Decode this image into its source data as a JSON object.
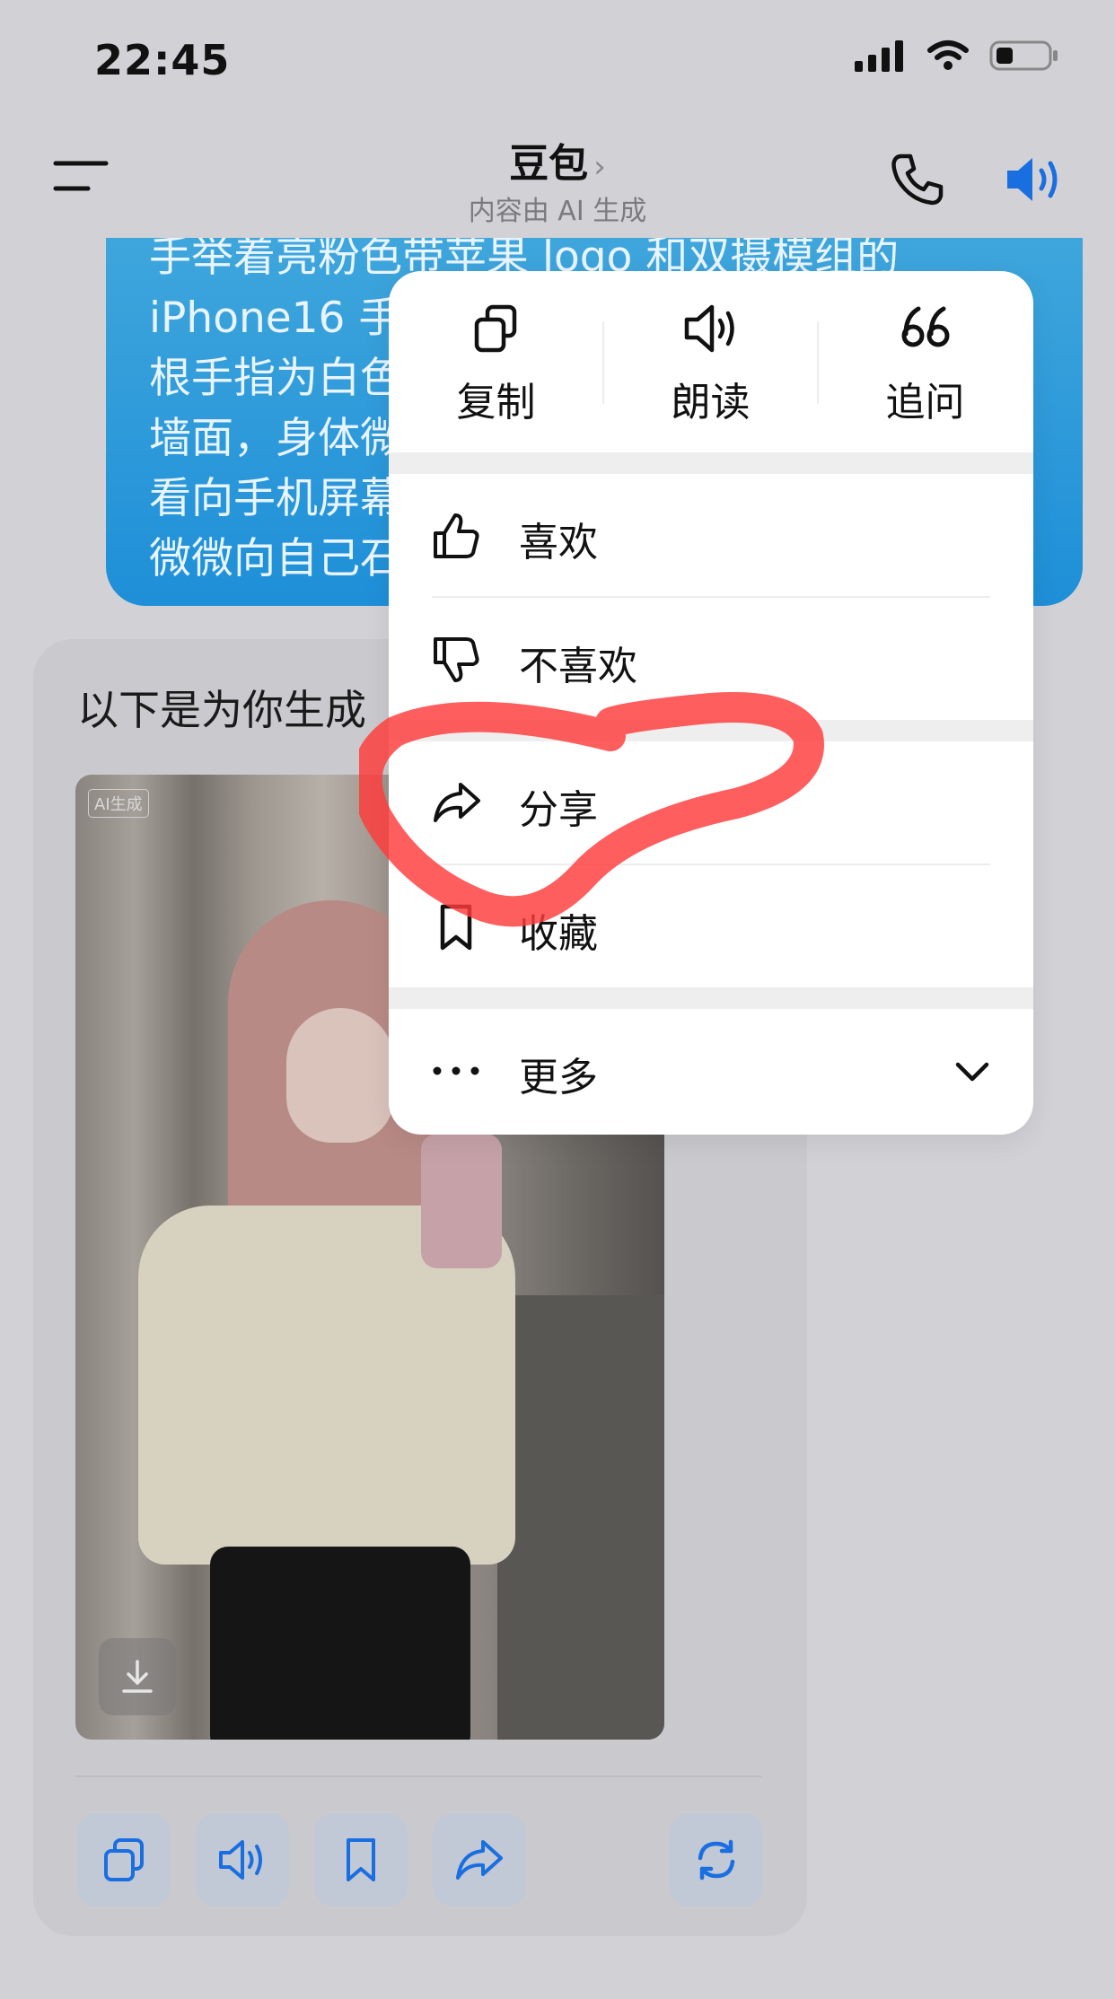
{
  "status_bar": {
    "time": "22:45"
  },
  "header": {
    "title": "豆包",
    "title_chevron": "›",
    "subtitle": "内容由 AI 生成"
  },
  "user_message": {
    "lines": [
      "手举着亮粉色带苹果 logo 和双摄模组的",
      "iPhone16 手",
      "根手指为白色",
      "墙面，身体微",
      "看向手机屏幕",
      "微微向自己石"
    ]
  },
  "assistant": {
    "intro_text": "以下是为你生成",
    "image_tag": "AI生成"
  },
  "context_menu": {
    "top_actions": [
      {
        "label": "复制",
        "icon": "copy-icon"
      },
      {
        "label": "朗读",
        "icon": "speaker-icon"
      },
      {
        "label": "追问",
        "icon": "quote-icon"
      }
    ],
    "items": [
      {
        "label": "喜欢",
        "icon": "thumbs-up-icon"
      },
      {
        "label": "不喜欢",
        "icon": "thumbs-down-icon"
      },
      {
        "label": "分享",
        "icon": "share-icon"
      },
      {
        "label": "收藏",
        "icon": "bookmark-icon"
      },
      {
        "label": "更多",
        "icon": "more-dots-icon"
      }
    ]
  },
  "colors": {
    "accent": "#1a6fe0",
    "bubble": "#1e8fd8",
    "annotation": "#ff3b3b",
    "overlay_background": "#d2d2d6"
  }
}
